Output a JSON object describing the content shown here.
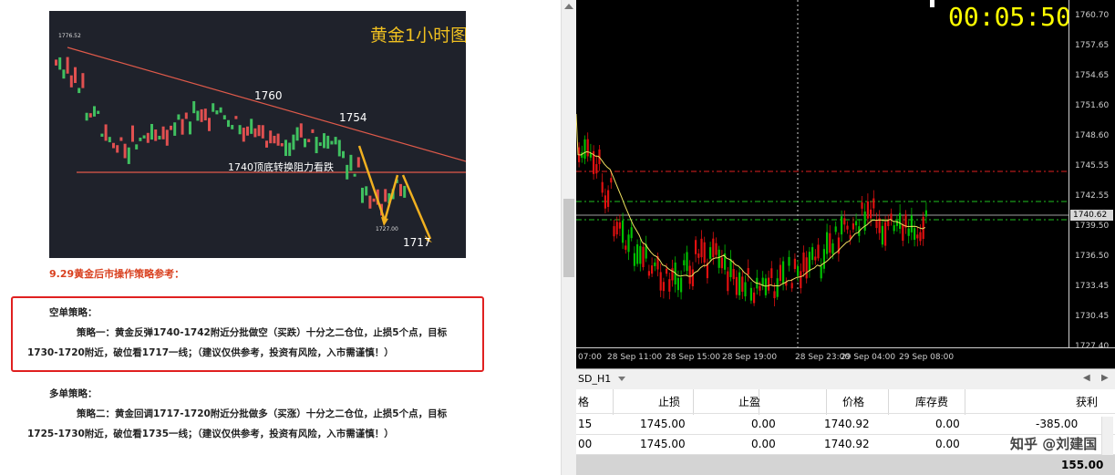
{
  "article": {
    "chart_title": "黄金1小时图",
    "level_top_left": "1776.52",
    "label_1760": "1760",
    "label_1754": "1754",
    "label_resistance": "1740顶底转换阻力看跌",
    "level_low": "1727.00",
    "label_1717": "1717",
    "heading": "9.29黄金后市操作策略参考：",
    "short_title": "空单策略：",
    "short_line1": "策略一：黄金反弹1740-1742附近分批做空（买跌）十分之二仓位，止损5个点，目标",
    "short_line2": "1730-1720附近，破位看1717一线；（建议仅供参考，投资有风险，入市需谨慎！）",
    "long_title": "多单策略：",
    "long_line1": "策略二：黄金回调1717-1720附近分批做多（买涨）十分之二仓位，止损5个点，目标",
    "long_line2": "1725-1730附近，破位看1735一线；（建议仅供参考，投资有风险，入市需谨慎！）",
    "highlight_color": "#e02020"
  },
  "terminal": {
    "countdown": "00:05:50",
    "current_price": "1740.62",
    "price_ticks": [
      "1760.70",
      "1757.65",
      "1754.65",
      "1751.60",
      "1748.60",
      "1745.55",
      "1742.55",
      "1739.50",
      "1736.50",
      "1733.45",
      "1730.45",
      "1727.40"
    ],
    "time_ticks": [
      "07:00",
      "28 Sep 11:00",
      "28 Sep 15:00",
      "28 Sep 19:00",
      "28 Sep 23:00",
      "29 Sep 04:00",
      "29 Sep 08:00"
    ],
    "tab_label": "SD_H1",
    "columns": [
      "格",
      "止损",
      "止盈",
      "价格",
      "库存费",
      "获利"
    ],
    "rows": [
      [
        "15",
        "1745.00",
        "0.00",
        "1740.92",
        "0.00",
        "-385.00"
      ],
      [
        "00",
        "1745.00",
        "0.00",
        "1740.92",
        "0.00",
        ""
      ]
    ],
    "total": "155.00",
    "watermark": "知乎 @刘建国",
    "colors": {
      "up": "#00c000",
      "down": "#e01010",
      "ma": "#f0e060",
      "sl_line": "#e02020",
      "entry_line": "#20c020",
      "clock": "#ffff00"
    }
  }
}
